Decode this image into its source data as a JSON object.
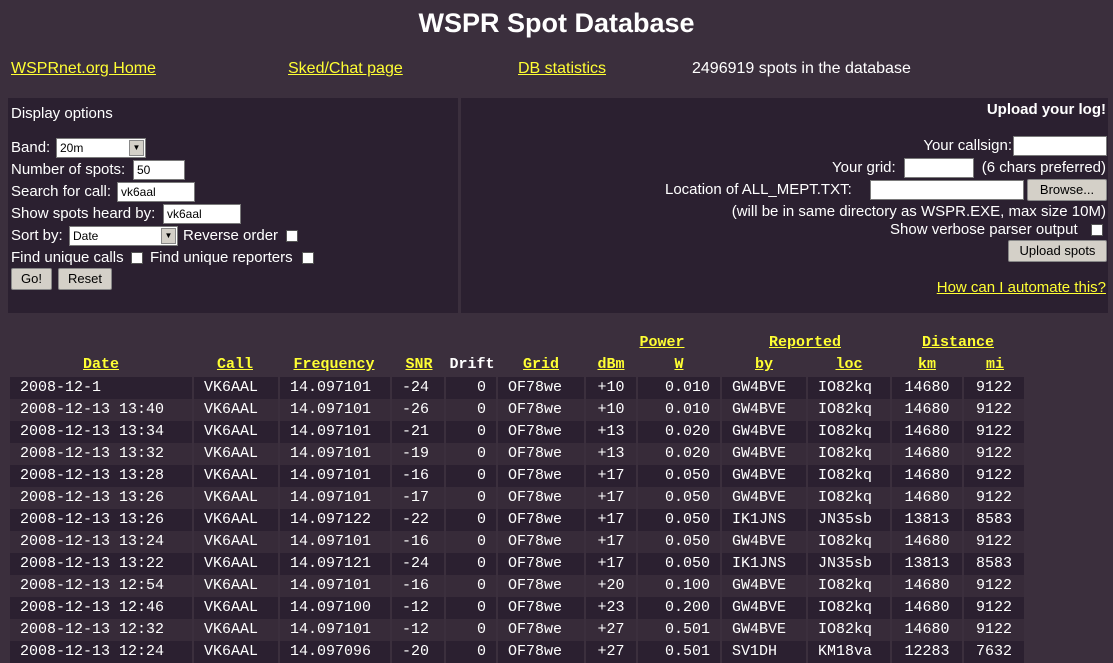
{
  "page": {
    "title": "WSPR Spot Database",
    "links": {
      "home": "WSPRnet.org Home",
      "sked": "Sked/Chat page",
      "stats": "DB statistics"
    },
    "spot_count": "2496919 spots in the database"
  },
  "display_options": {
    "title": "Display options",
    "band_label": "Band:",
    "band_value": "20m",
    "num_spots_label": "Number of spots:",
    "num_spots_value": "50",
    "search_call_label": "Search for call:",
    "search_call_value": "vk6aal",
    "heard_by_label": "Show spots heard by:",
    "heard_by_value": "vk6aal",
    "sort_label": "Sort by:",
    "sort_value": "Date",
    "reverse_label": "Reverse order",
    "unique_calls_label": "Find unique calls",
    "unique_reporters_label": "Find unique reporters",
    "go_button": "Go!",
    "reset_button": "Reset"
  },
  "upload": {
    "title": "Upload your log!",
    "callsign_label": "Your callsign:",
    "grid_label": "Your grid:",
    "grid_hint": "(6 chars preferred)",
    "location_label": "Location of ALL_MEPT.TXT:",
    "browse_button": "Browse...",
    "note": "(will be in same directory as WSPR.EXE, max size 10M)",
    "verbose_label": "Show verbose parser output",
    "upload_button": "Upload spots",
    "automate_link": "How can I automate this?"
  },
  "table": {
    "group_headers": {
      "power": "Power",
      "reported": "Reported",
      "distance": "Distance"
    },
    "headers": {
      "date": "Date",
      "call": "Call",
      "frequency": "Frequency",
      "snr": "SNR",
      "drift": "Drift",
      "grid": "Grid",
      "dbm": "dBm",
      "w": "W",
      "by": "by",
      "loc": "loc",
      "km": "km",
      "mi": "mi"
    },
    "rows": [
      [
        "2008-12-1",
        "VK6AAL",
        "14.097101",
        "-24",
        "0",
        "OF78we",
        "+10",
        "0.010",
        "GW4BVE",
        "IO82kq",
        "14680",
        "9122"
      ],
      [
        "2008-12-13 13:40",
        "VK6AAL",
        "14.097101",
        "-26",
        "0",
        "OF78we",
        "+10",
        "0.010",
        "GW4BVE",
        "IO82kq",
        "14680",
        "9122"
      ],
      [
        "2008-12-13 13:34",
        "VK6AAL",
        "14.097101",
        "-21",
        "0",
        "OF78we",
        "+13",
        "0.020",
        "GW4BVE",
        "IO82kq",
        "14680",
        "9122"
      ],
      [
        "2008-12-13 13:32",
        "VK6AAL",
        "14.097101",
        "-19",
        "0",
        "OF78we",
        "+13",
        "0.020",
        "GW4BVE",
        "IO82kq",
        "14680",
        "9122"
      ],
      [
        "2008-12-13 13:28",
        "VK6AAL",
        "14.097101",
        "-16",
        "0",
        "OF78we",
        "+17",
        "0.050",
        "GW4BVE",
        "IO82kq",
        "14680",
        "9122"
      ],
      [
        "2008-12-13 13:26",
        "VK6AAL",
        "14.097101",
        "-17",
        "0",
        "OF78we",
        "+17",
        "0.050",
        "GW4BVE",
        "IO82kq",
        "14680",
        "9122"
      ],
      [
        "2008-12-13 13:26",
        "VK6AAL",
        "14.097122",
        "-22",
        "0",
        "OF78we",
        "+17",
        "0.050",
        "IK1JNS",
        "JN35sb",
        "13813",
        "8583"
      ],
      [
        "2008-12-13 13:24",
        "VK6AAL",
        "14.097101",
        "-16",
        "0",
        "OF78we",
        "+17",
        "0.050",
        "GW4BVE",
        "IO82kq",
        "14680",
        "9122"
      ],
      [
        "2008-12-13 13:22",
        "VK6AAL",
        "14.097121",
        "-24",
        "0",
        "OF78we",
        "+17",
        "0.050",
        "IK1JNS",
        "JN35sb",
        "13813",
        "8583"
      ],
      [
        "2008-12-13 12:54",
        "VK6AAL",
        "14.097101",
        "-16",
        "0",
        "OF78we",
        "+20",
        "0.100",
        "GW4BVE",
        "IO82kq",
        "14680",
        "9122"
      ],
      [
        "2008-12-13 12:46",
        "VK6AAL",
        "14.097100",
        "-12",
        "0",
        "OF78we",
        "+23",
        "0.200",
        "GW4BVE",
        "IO82kq",
        "14680",
        "9122"
      ],
      [
        "2008-12-13 12:32",
        "VK6AAL",
        "14.097101",
        "-12",
        "0",
        "OF78we",
        "+27",
        "0.501",
        "GW4BVE",
        "IO82kq",
        "14680",
        "9122"
      ],
      [
        "2008-12-13 12:24",
        "VK6AAL",
        "14.097096",
        "-20",
        "0",
        "OF78we",
        "+27",
        "0.501",
        "SV1DH",
        "KM18va",
        "12283",
        "7632"
      ]
    ]
  },
  "colors": {
    "background": "#3b2f3d",
    "panel": "#2b2030",
    "link": "#ffff33",
    "text": "#ffffff"
  }
}
